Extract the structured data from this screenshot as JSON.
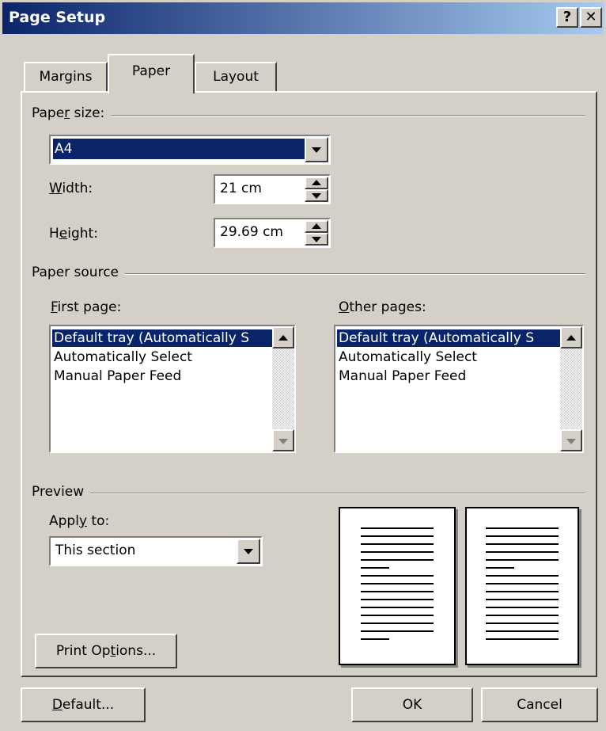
{
  "window": {
    "title": "Page Setup",
    "help_label": "?",
    "close_label": "✕"
  },
  "tabs": [
    {
      "label": "Margins",
      "active": false
    },
    {
      "label": "Paper",
      "active": true
    },
    {
      "label": "Layout",
      "active": false
    }
  ],
  "paper_size": {
    "group_label_pre": "Pape",
    "group_label_u": "r",
    "group_label_post": " size:",
    "selected": "A4",
    "width_label_u": "W",
    "width_label_post": "idth:",
    "width_value": "21 cm",
    "height_label_pre": "H",
    "height_label_u": "e",
    "height_label_post": "ight:",
    "height_value": "29.69 cm"
  },
  "paper_source": {
    "group_label": "Paper source",
    "first_page_label_u": "F",
    "first_page_label_post": "irst page:",
    "other_pages_label_u": "O",
    "other_pages_label_post": "ther pages:",
    "first_page_items": [
      "Default tray (Automatically S",
      "Automatically Select",
      "Manual Paper Feed"
    ],
    "other_pages_items": [
      "Default tray (Automatically S",
      "Automatically Select",
      "Manual Paper Feed"
    ]
  },
  "preview": {
    "group_label": "Preview",
    "apply_to_label_pre": "Appl",
    "apply_to_label_u": "y",
    "apply_to_label_post": " to:",
    "apply_to_value": "This section"
  },
  "buttons": {
    "print_options_pre": "Print Op",
    "print_options_u": "t",
    "print_options_post": "ions...",
    "default_u": "D",
    "default_post": "efault...",
    "ok": "OK",
    "cancel": "Cancel"
  }
}
